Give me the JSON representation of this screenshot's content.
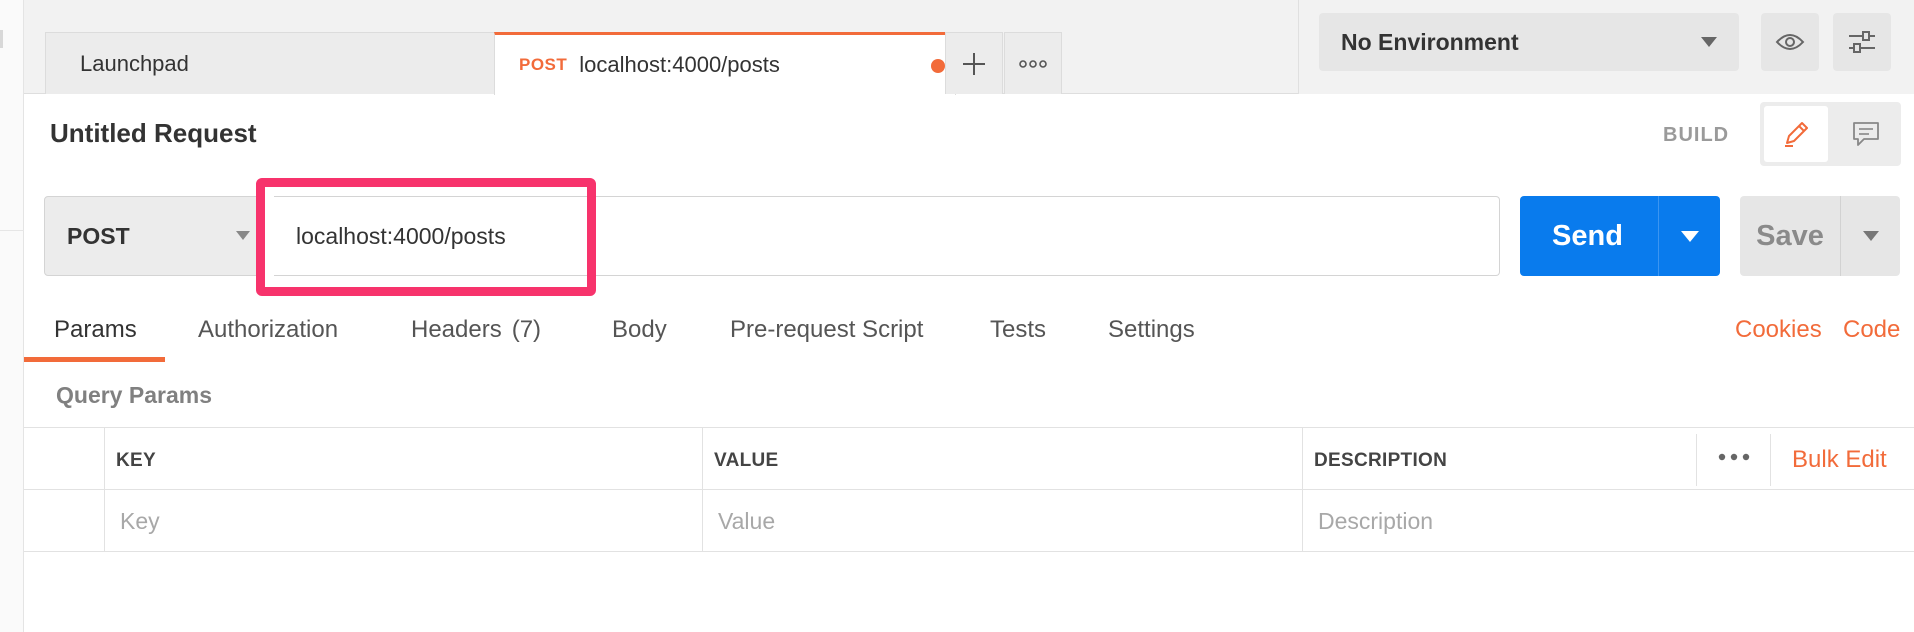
{
  "tabs": [
    {
      "label": "Launchpad"
    },
    {
      "method": "POST",
      "label": "localhost:4000/posts",
      "unsaved": true
    }
  ],
  "tab_actions": {
    "new_tab_icon": "plus-icon",
    "more_icon": "ellipsis-icon"
  },
  "environment": {
    "selected": "No Environment",
    "eye_icon": "eye-icon",
    "settings_icon": "sliders-icon"
  },
  "request": {
    "title": "Untitled Request",
    "mode_label": "BUILD",
    "method": "POST",
    "url": "localhost:4000/posts",
    "send_label": "Send",
    "save_label": "Save"
  },
  "request_tabs": [
    {
      "label": "Params",
      "active": true
    },
    {
      "label": "Authorization"
    },
    {
      "label": "Headers",
      "count": "(7)"
    },
    {
      "label": "Body"
    },
    {
      "label": "Pre-request Script"
    },
    {
      "label": "Tests"
    },
    {
      "label": "Settings"
    }
  ],
  "links": {
    "cookies": "Cookies",
    "code": "Code"
  },
  "query_params": {
    "section_label": "Query Params",
    "columns": [
      "KEY",
      "VALUE",
      "DESCRIPTION"
    ],
    "placeholders": {
      "key": "Key",
      "value": "Value",
      "description": "Description"
    },
    "bulk_edit_label": "Bulk Edit"
  },
  "colors": {
    "accent": "#f26b3a",
    "primary": "#097bed",
    "highlight": "#f7336c"
  }
}
